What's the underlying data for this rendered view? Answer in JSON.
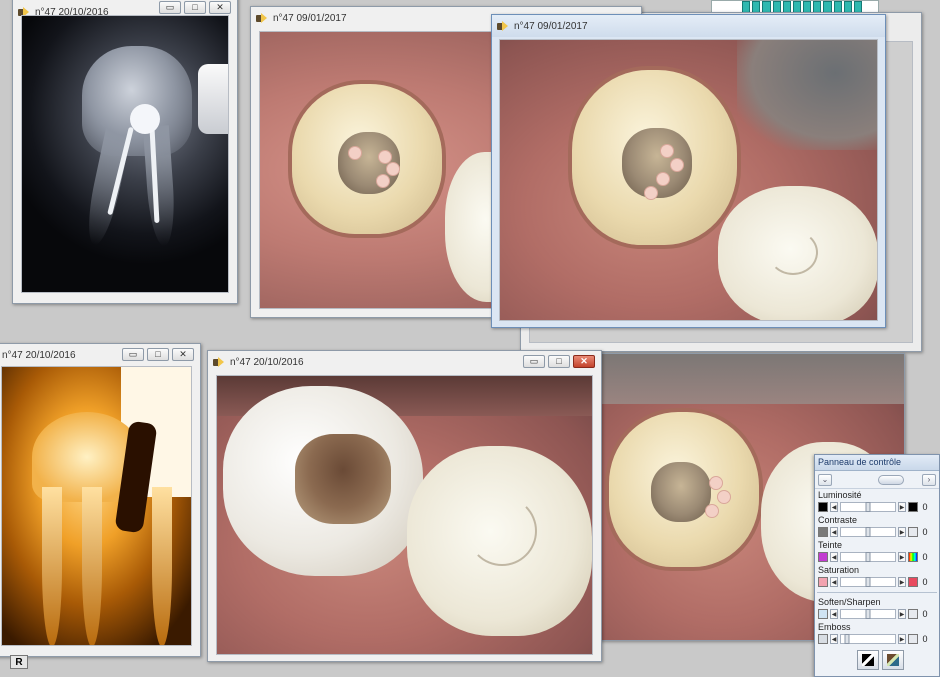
{
  "windows": {
    "xray": {
      "title": "n°47 20/10/2016"
    },
    "photo_back": {
      "title": "n°47 09/01/2017"
    },
    "photo_front": {
      "title": "n°47 09/01/2017"
    },
    "orange_xray": {
      "title": "n°47 20/10/2016"
    },
    "photo_bottom": {
      "title": "n°47 20/10/2016"
    }
  },
  "window_buttons": {
    "minimize": "▭",
    "maximize": "□",
    "close": "✕"
  },
  "control_panel": {
    "title": "Panneau de contrôle",
    "tools": {
      "dropdown": "⌄",
      "right": "›"
    },
    "controls": [
      {
        "label": "Luminosité",
        "value": "0",
        "level": 50,
        "swatch": "#000000"
      },
      {
        "label": "Contraste",
        "value": "0",
        "level": 50,
        "swatch": "#7a7a7a"
      },
      {
        "label": "Teinte",
        "value": "0",
        "level": 50,
        "swatch": "#c23bd1"
      },
      {
        "label": "Saturation",
        "value": "0",
        "level": 50,
        "swatch": "#f2a3b0"
      },
      {
        "label": "Soften/Sharpen",
        "value": "0",
        "level": 50,
        "swatch": "#cfe3f3"
      },
      {
        "label": "Emboss",
        "value": "0",
        "level": 12,
        "swatch": "#d8dde3"
      }
    ],
    "arrow_left": "◀",
    "arrow_right": "▶"
  },
  "bottom_button": {
    "label": "R"
  },
  "colors": {
    "window_border": "#8e9aa8",
    "active_title": "#cfdcec",
    "close_red": "#c2432c"
  }
}
